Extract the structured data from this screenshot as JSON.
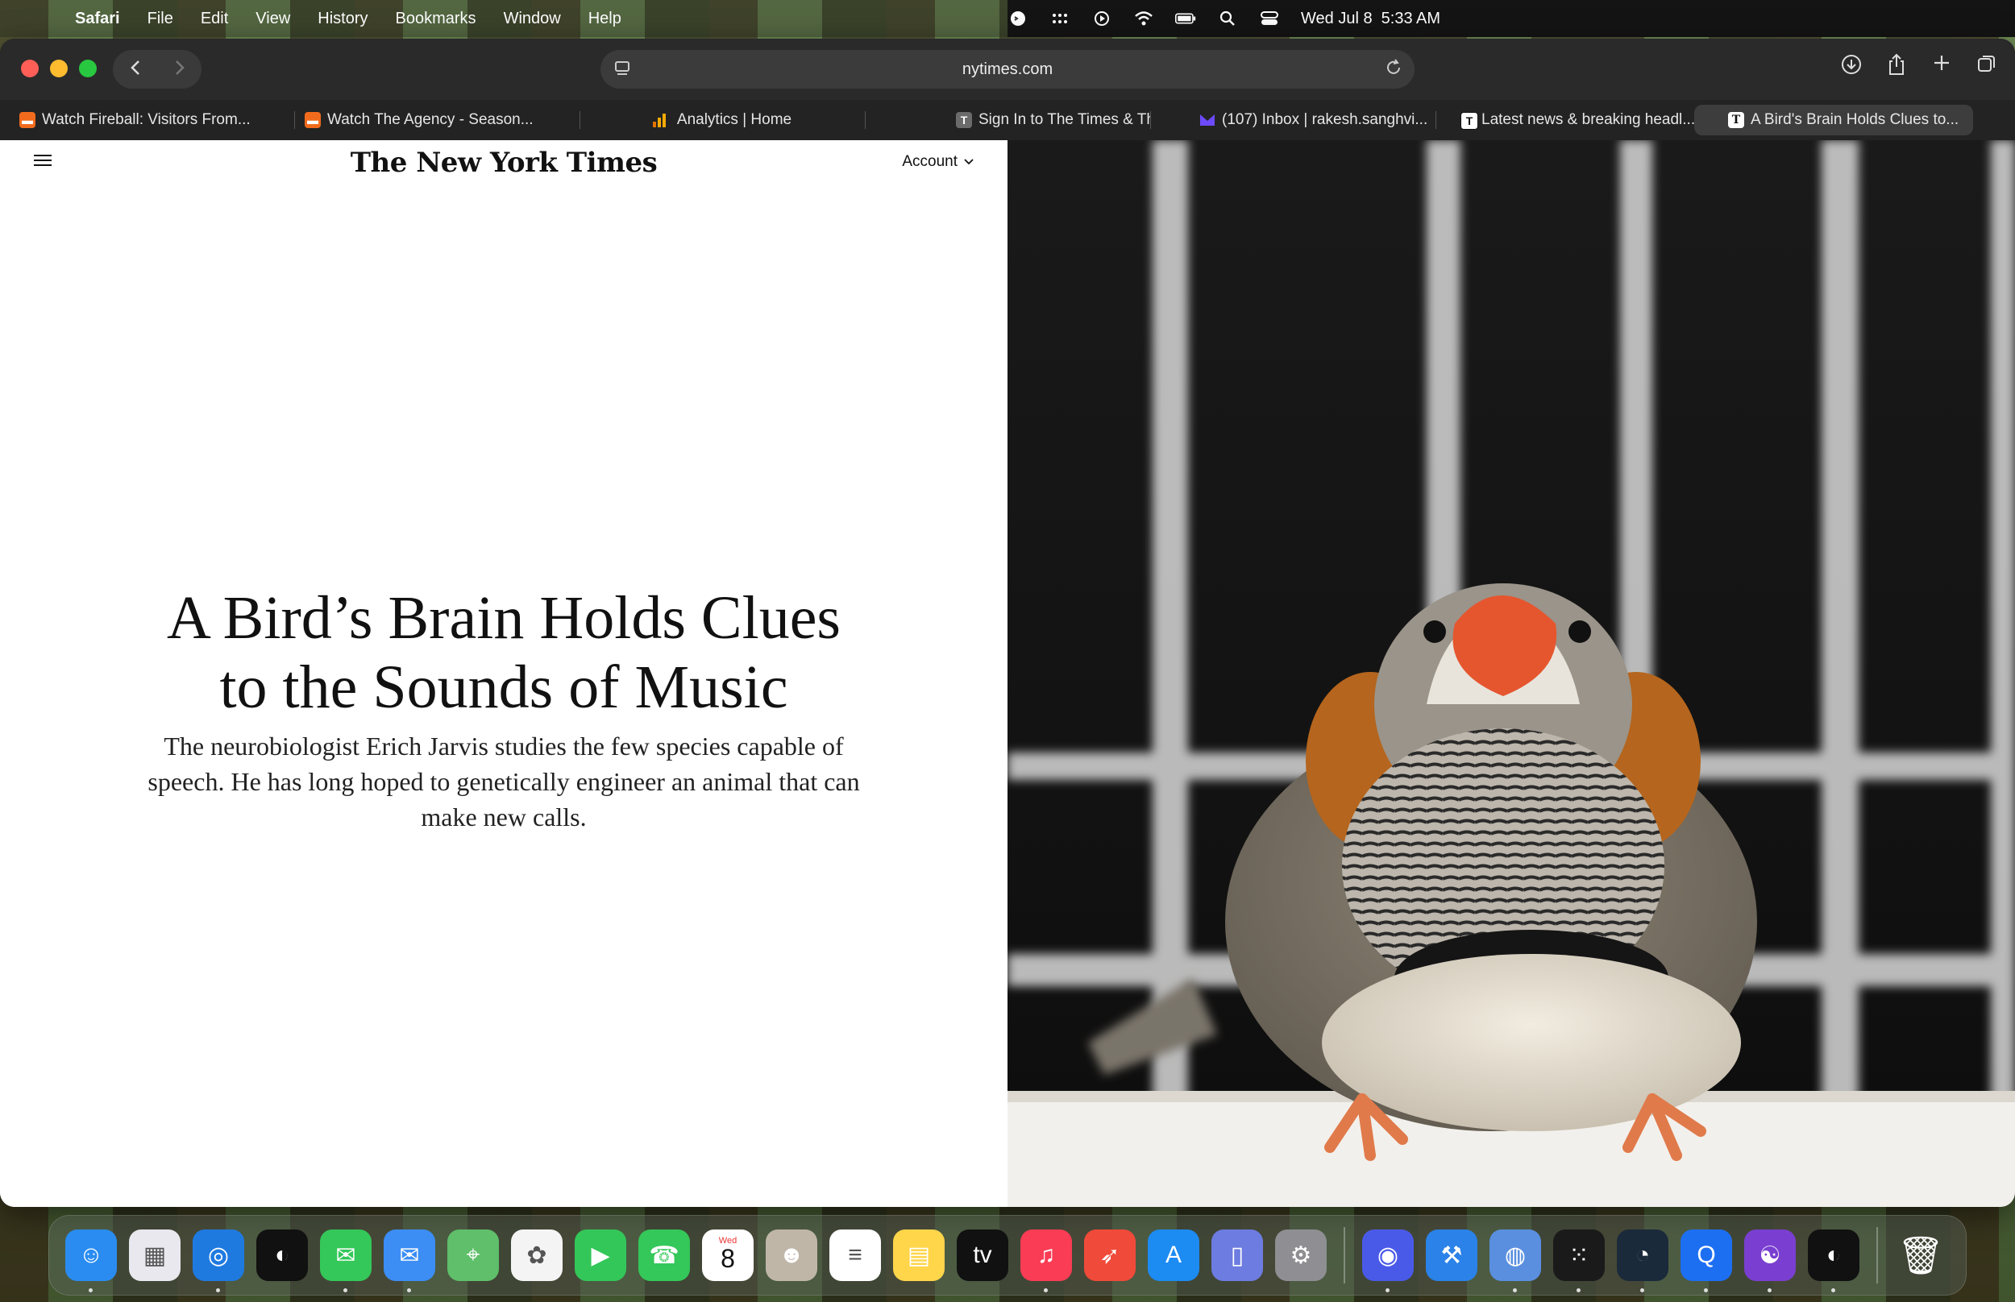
{
  "menubar": {
    "app_name": "Safari",
    "items": [
      "File",
      "Edit",
      "View",
      "History",
      "Bookmarks",
      "Window",
      "Help"
    ],
    "clock": "Wed Jul 8  5:33 AM",
    "status_icons": [
      "chatgpt-icon",
      "dots-grid-icon",
      "play-circle-icon",
      "wifi-icon",
      "battery-icon",
      "search-icon",
      "control-center-icon"
    ]
  },
  "browser": {
    "url": "nytimes.com",
    "tabs": [
      {
        "label": "Watch Fireball: Visitors From...",
        "icon": "orange-tv-icon",
        "color": "#f26b1d"
      },
      {
        "label": "Watch The Agency - Season...",
        "icon": "orange-tv-icon",
        "color": "#f26b1d"
      },
      {
        "label": "Analytics | Home",
        "icon": "analytics-icon",
        "color": "#f9ab00"
      },
      {
        "label": "Sign In to The Times & The S...",
        "icon": "T",
        "color": "#6b6b6b"
      },
      {
        "label": "(107) Inbox | rakesh.sanghvi...",
        "icon": "proton-mail-icon",
        "color": "#6d4aff"
      },
      {
        "label": "Latest news & breaking headl...",
        "icon": "T",
        "color": "#111111"
      },
      {
        "label": "A Bird's Brain Holds Clues to...",
        "icon": "nyt-icon",
        "color": "#ffffff",
        "active": true
      }
    ]
  },
  "article": {
    "masthead": "The New York Times",
    "account_label": "Account",
    "headline_line1": "A Bird’s Brain Holds Clues",
    "headline_line2": "to the Sounds of Music",
    "dek": "The neurobiologist Erich Jarvis studies the few species capable of speech. He has long hoped to genetically engineer an animal that can make new calls."
  },
  "dock": {
    "apps": [
      {
        "name": "finder",
        "color": "#2a8cf0",
        "glyph": "☺",
        "running": true
      },
      {
        "name": "launchpad",
        "color": "#e8e8ee",
        "glyph": "▦",
        "running": false
      },
      {
        "name": "safari",
        "color": "#1f7ae0",
        "glyph": "◎",
        "running": true
      },
      {
        "name": "podcast-app",
        "color": "#111111",
        "glyph": "◐",
        "running": false
      },
      {
        "name": "messages",
        "color": "#34c759",
        "glyph": "✉",
        "running": true
      },
      {
        "name": "mail",
        "color": "#3c8ef5",
        "glyph": "✉",
        "running": true
      },
      {
        "name": "maps",
        "color": "#5fbf6a",
        "glyph": "⌖",
        "running": false
      },
      {
        "name": "photos",
        "color": "#f4f4f4",
        "glyph": "✿",
        "running": false
      },
      {
        "name": "facetime",
        "color": "#33c759",
        "glyph": "▶",
        "running": false
      },
      {
        "name": "phone",
        "color": "#34c759",
        "glyph": "☎",
        "running": false
      },
      {
        "name": "calendar",
        "color": "#ffffff",
        "glyph": "8",
        "running": false
      },
      {
        "name": "contacts",
        "color": "#bfb6a8",
        "glyph": "☻",
        "running": false
      },
      {
        "name": "reminders",
        "color": "#ffffff",
        "glyph": "≡",
        "running": false
      },
      {
        "name": "notes",
        "color": "#ffd54a",
        "glyph": "▤",
        "running": false
      },
      {
        "name": "apple-tv",
        "color": "#111111",
        "glyph": "tv",
        "running": false
      },
      {
        "name": "music",
        "color": "#fa3c55",
        "glyph": "♫",
        "running": true
      },
      {
        "name": "rocket-app",
        "color": "#f04a3a",
        "glyph": "➶",
        "running": false
      },
      {
        "name": "app-store",
        "color": "#1c8bf2",
        "glyph": "A",
        "running": false
      },
      {
        "name": "configurator",
        "color": "#6d7ce0",
        "glyph": "▯",
        "running": false
      },
      {
        "name": "system-settings",
        "color": "#8e8e93",
        "glyph": "⚙",
        "running": false
      },
      {
        "name": "sep",
        "color": "",
        "glyph": "",
        "running": false
      },
      {
        "name": "chat-app",
        "color": "#4a5ae8",
        "glyph": "◉",
        "running": true
      },
      {
        "name": "xcode",
        "color": "#2b82e8",
        "glyph": "⚒",
        "running": false
      },
      {
        "name": "disk-utility",
        "color": "#5a8fe0",
        "glyph": "◍",
        "running": true
      },
      {
        "name": "dots-app",
        "color": "#1a1a1a",
        "glyph": "⁙",
        "running": true
      },
      {
        "name": "speed-test",
        "color": "#1a2a3a",
        "glyph": "◔",
        "running": true
      },
      {
        "name": "quick-app",
        "color": "#1d6ff2",
        "glyph": "Q",
        "running": true
      },
      {
        "name": "github-desktop",
        "color": "#7a3fd0",
        "glyph": "☯",
        "running": true
      },
      {
        "name": "podcast-app-2",
        "color": "#111111",
        "glyph": "◐",
        "running": true
      },
      {
        "name": "sep",
        "color": "",
        "glyph": "",
        "running": false
      },
      {
        "name": "trash",
        "color": "transparent",
        "glyph": "🗑",
        "running": false
      }
    ],
    "calendar_day": "Wed"
  }
}
